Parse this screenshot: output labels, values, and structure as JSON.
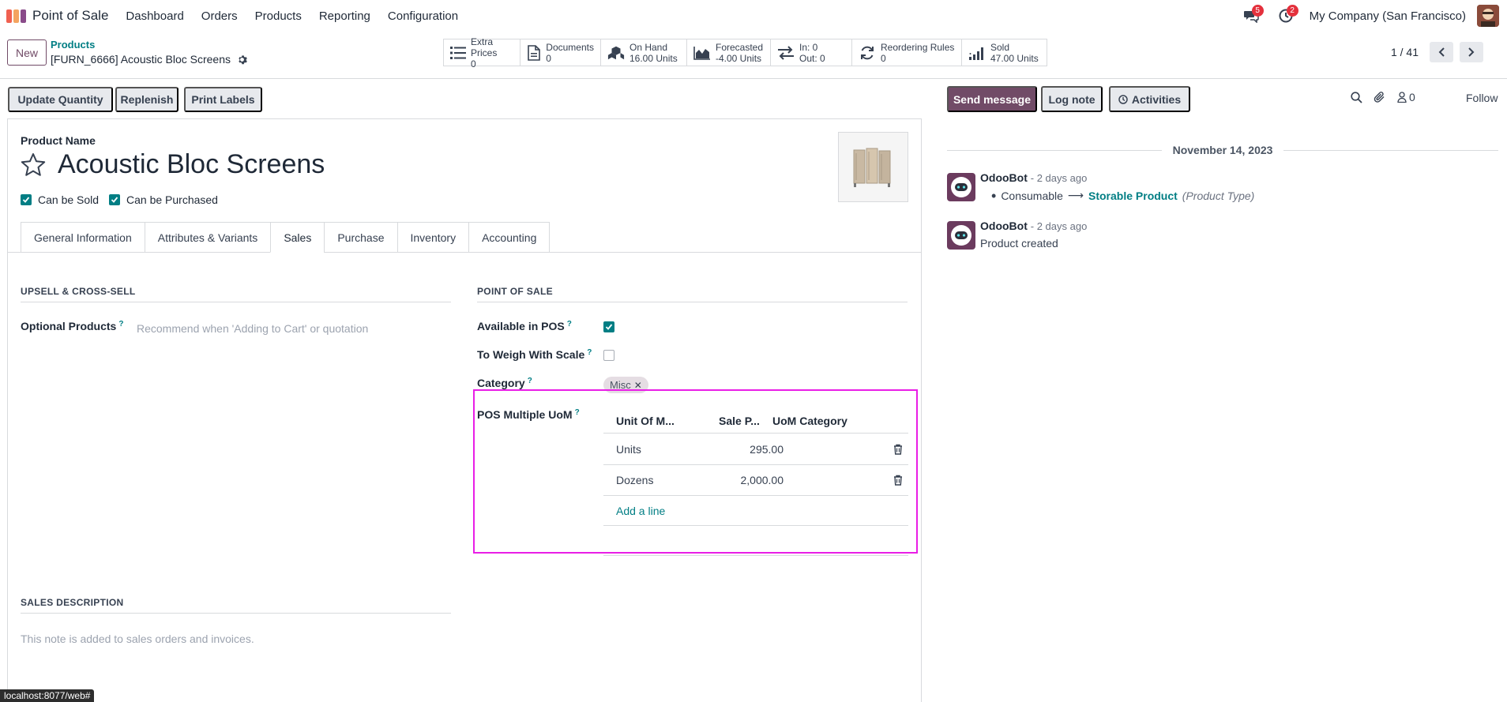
{
  "navbar": {
    "app_name": "Point of Sale",
    "menus": [
      "Dashboard",
      "Orders",
      "Products",
      "Reporting",
      "Configuration"
    ],
    "messages_badge": "5",
    "activities_badge": "2",
    "company": "My Company (San Francisco)"
  },
  "control": {
    "new_label": "New",
    "breadcrumb": "Products",
    "record": "[FURN_6666] Acoustic Bloc Screens",
    "smart_buttons": [
      {
        "icon": "list-icon",
        "label": "Extra Prices",
        "value": "0"
      },
      {
        "icon": "document-icon",
        "label": "Documents",
        "value": "0"
      },
      {
        "icon": "cubes-icon",
        "label": "On Hand",
        "value": "16.00 Units"
      },
      {
        "icon": "area-chart-icon",
        "label": "Forecasted",
        "value": "-4.00 Units"
      },
      {
        "icon": "exchange-icon",
        "label": "In: 0",
        "value": "Out: 0"
      },
      {
        "icon": "refresh-icon",
        "label": "Reordering Rules",
        "value": "0"
      },
      {
        "icon": "signal-icon",
        "label": "Sold",
        "value": "47.00 Units"
      }
    ],
    "pager": "1 / 41"
  },
  "actions": {
    "update_quantity": "Update Quantity",
    "replenish": "Replenish",
    "print_labels": "Print Labels"
  },
  "form": {
    "product_name_label": "Product Name",
    "product_name": "Acoustic Bloc Screens",
    "can_be_sold": "Can be Sold",
    "can_be_purchased": "Can be Purchased",
    "tabs": [
      "General Information",
      "Attributes & Variants",
      "Sales",
      "Purchase",
      "Inventory",
      "Accounting"
    ],
    "active_tab": "Sales",
    "upsell_title": "UPSELL & CROSS-SELL",
    "optional_products_label": "Optional Products",
    "optional_products_placeholder": "Recommend when 'Adding to Cart' or quotation",
    "pos_title": "POINT OF SALE",
    "available_in_pos_label": "Available in POS",
    "available_in_pos": true,
    "to_weigh_label": "To Weigh With Scale",
    "to_weigh": false,
    "category_label": "Category",
    "category_tag": "Misc",
    "pos_uom_label": "POS Multiple UoM",
    "uom_headers": [
      "Unit Of M...",
      "Sale P...",
      "UoM Category"
    ],
    "uom_rows": [
      {
        "unit": "Units",
        "price": "295.00",
        "category": ""
      },
      {
        "unit": "Dozens",
        "price": "2,000.00",
        "category": ""
      }
    ],
    "add_line": "Add a line",
    "sales_description_title": "SALES DESCRIPTION",
    "sales_description_placeholder": "This note is added to sales orders and invoices."
  },
  "status_url": "localhost:8077/web#",
  "chatter": {
    "send_message": "Send message",
    "log_note": "Log note",
    "activities": "Activities",
    "followers_count": "0",
    "follow": "Follow",
    "date": "November 14, 2023",
    "messages": [
      {
        "author": "OdooBot",
        "time": "- 2 days ago",
        "old_value": "Consumable",
        "new_value": "Storable Product",
        "field": "(Product Type)"
      },
      {
        "author": "OdooBot",
        "time": "- 2 days ago",
        "body": "Product created"
      }
    ]
  },
  "colors": {
    "primary": "#714b67",
    "teal": "#017e84",
    "badge": "#e4303c",
    "highlight": "#e91ee6"
  }
}
